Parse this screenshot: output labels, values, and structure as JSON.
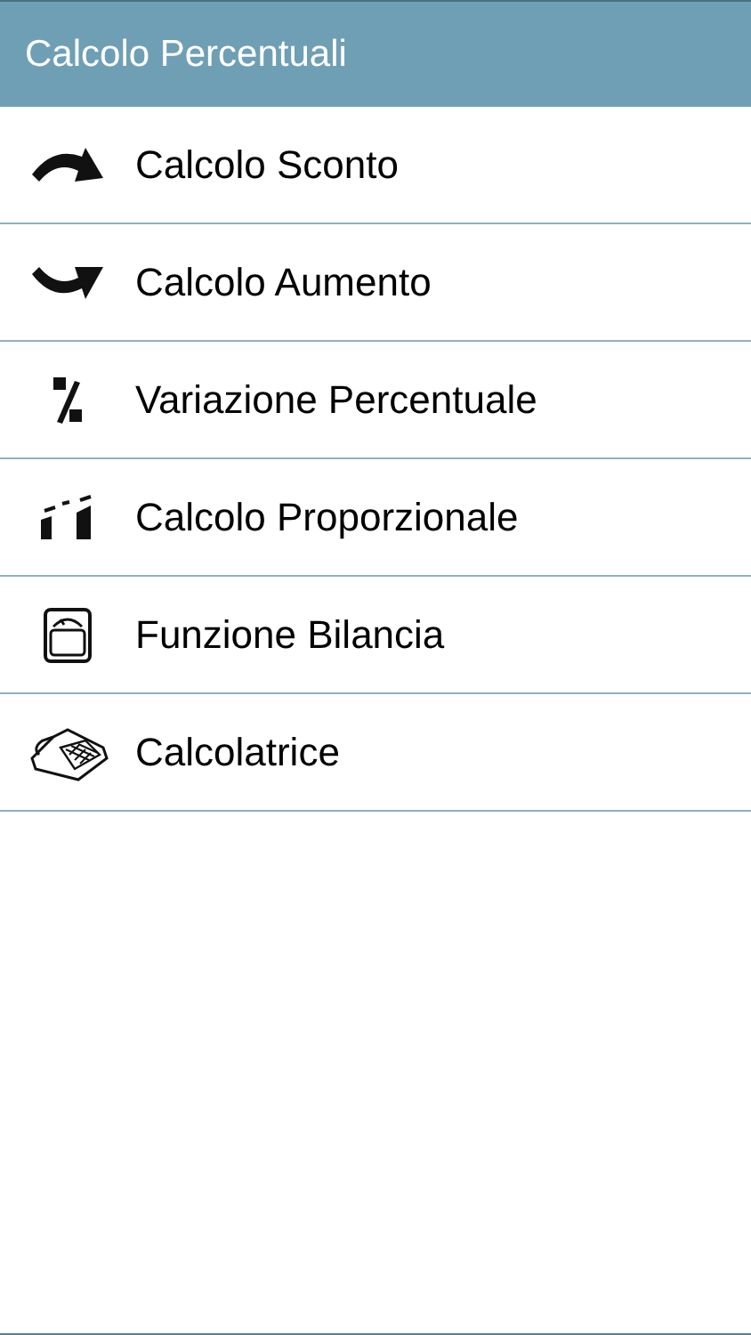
{
  "header": {
    "title": "Calcolo Percentuali"
  },
  "items": [
    {
      "kind": "discount",
      "label": "Calcolo Sconto"
    },
    {
      "kind": "increase",
      "label": "Calcolo Aumento"
    },
    {
      "kind": "percent",
      "label": "Variazione Percentuale"
    },
    {
      "kind": "proportion",
      "label": "Calcolo Proporzionale"
    },
    {
      "kind": "scale",
      "label": "Funzione Bilancia"
    },
    {
      "kind": "calculator",
      "label": "Calcolatrice"
    }
  ]
}
